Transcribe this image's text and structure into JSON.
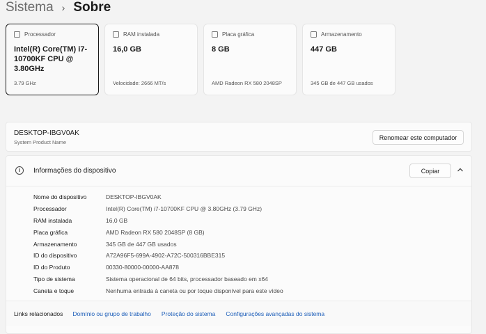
{
  "breadcrumb": {
    "parent": "Sistema",
    "separator": "›",
    "current": "Sobre"
  },
  "cards": [
    {
      "icon": "processor-icon",
      "title": "Processador",
      "value": "Intel(R) Core(TM) i7-10700KF CPU @ 3.80GHz",
      "sub": "3.79 GHz"
    },
    {
      "icon": "ram-icon",
      "title": "RAM instalada",
      "value": "16,0 GB",
      "sub": "Velocidade: 2666 MT/s"
    },
    {
      "icon": "gpu-icon",
      "title": "Placa gráfica",
      "value": "8 GB",
      "sub": "AMD Radeon RX 580 2048SP"
    },
    {
      "icon": "storage-icon",
      "title": "Armazenamento",
      "value": "447 GB",
      "sub": "345 GB de 447 GB usados"
    }
  ],
  "device": {
    "name": "DESKTOP-IBGV0AK",
    "subtitle": "System Product Name",
    "rename_label": "Renomear este computador"
  },
  "info": {
    "title": "Informações do dispositivo",
    "copy_label": "Copiar",
    "rows": [
      {
        "label": "Nome do dispositivo",
        "value": "DESKTOP-IBGV0AK"
      },
      {
        "label": "Processador",
        "value": "Intel(R) Core(TM) i7-10700KF CPU @ 3.80GHz (3.79 GHz)"
      },
      {
        "label": "RAM instalada",
        "value": "16,0 GB"
      },
      {
        "label": "Placa gráfica",
        "value": "AMD Radeon RX 580 2048SP (8 GB)"
      },
      {
        "label": "Armazenamento",
        "value": "345 GB de 447 GB usados"
      },
      {
        "label": "ID do dispositivo",
        "value": "A72A96F5-699A-4902-A72C-500316BBE315"
      },
      {
        "label": "ID do Produto",
        "value": "00330-80000-00000-AA878"
      },
      {
        "label": "Tipo de sistema",
        "value": "Sistema operacional de 64 bits, processador baseado em x64"
      },
      {
        "label": "Caneta e toque",
        "value": "Nenhuma entrada à caneta ou por toque disponível para este vídeo"
      }
    ]
  },
  "links": {
    "label": "Links relacionados",
    "items": [
      "Domínio ou grupo de trabalho",
      "Proteção do sistema",
      "Configurações avançadas do sistema"
    ]
  }
}
